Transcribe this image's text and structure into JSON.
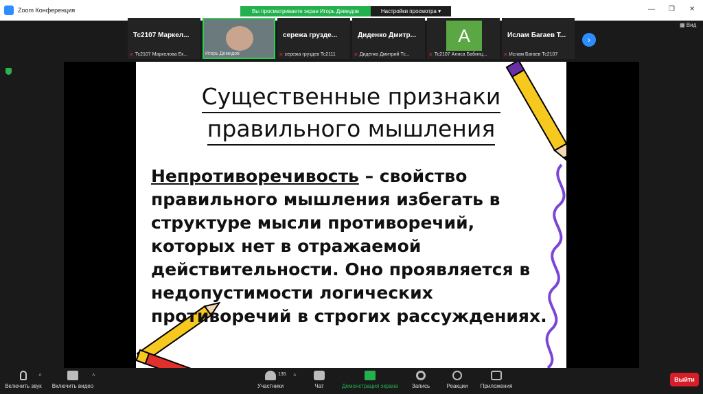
{
  "window": {
    "title": "Zoom Конференция",
    "share_banner": "Вы просматриваете экран Игорь Демидов",
    "view_options": "Настройки просмотра",
    "view_button": "Вид"
  },
  "participants": [
    {
      "name": "Тс2107 Маркел...",
      "sub": "Тс2107 Маркелова Ек..."
    },
    {
      "name": "",
      "sub": "Игорь Демидов"
    },
    {
      "name": "сережа грузде...",
      "sub": "сережа груздев Тс2111"
    },
    {
      "name": "Диденко Дмитр...",
      "sub": "Диденко Дмитрий Тс..."
    },
    {
      "name": "",
      "avatar": "А",
      "sub": "Тс2107 Алиса Бабинц..."
    },
    {
      "name": "Ислам Багаев Т...",
      "sub": "Ислам Багаев Тс2107"
    }
  ],
  "slide": {
    "title_line1": "Существенные признаки",
    "title_line2": "правильного мышления",
    "term": "Непротиворечивость",
    "body": " – свойство правильного мышления избегать в структуре мысли противоречий, которых нет в отражаемой действительности. Оно проявляется в недопустимости логических противоречий в строгих рассуждениях."
  },
  "toolbar": {
    "audio": "Включить звук",
    "video": "Включить видео",
    "participants": "Участники",
    "participants_count": "135",
    "chat": "Чат",
    "share": "Демонстрация экрана",
    "record": "Запись",
    "reactions": "Реакции",
    "apps": "Приложения",
    "exit": "Выйти"
  }
}
